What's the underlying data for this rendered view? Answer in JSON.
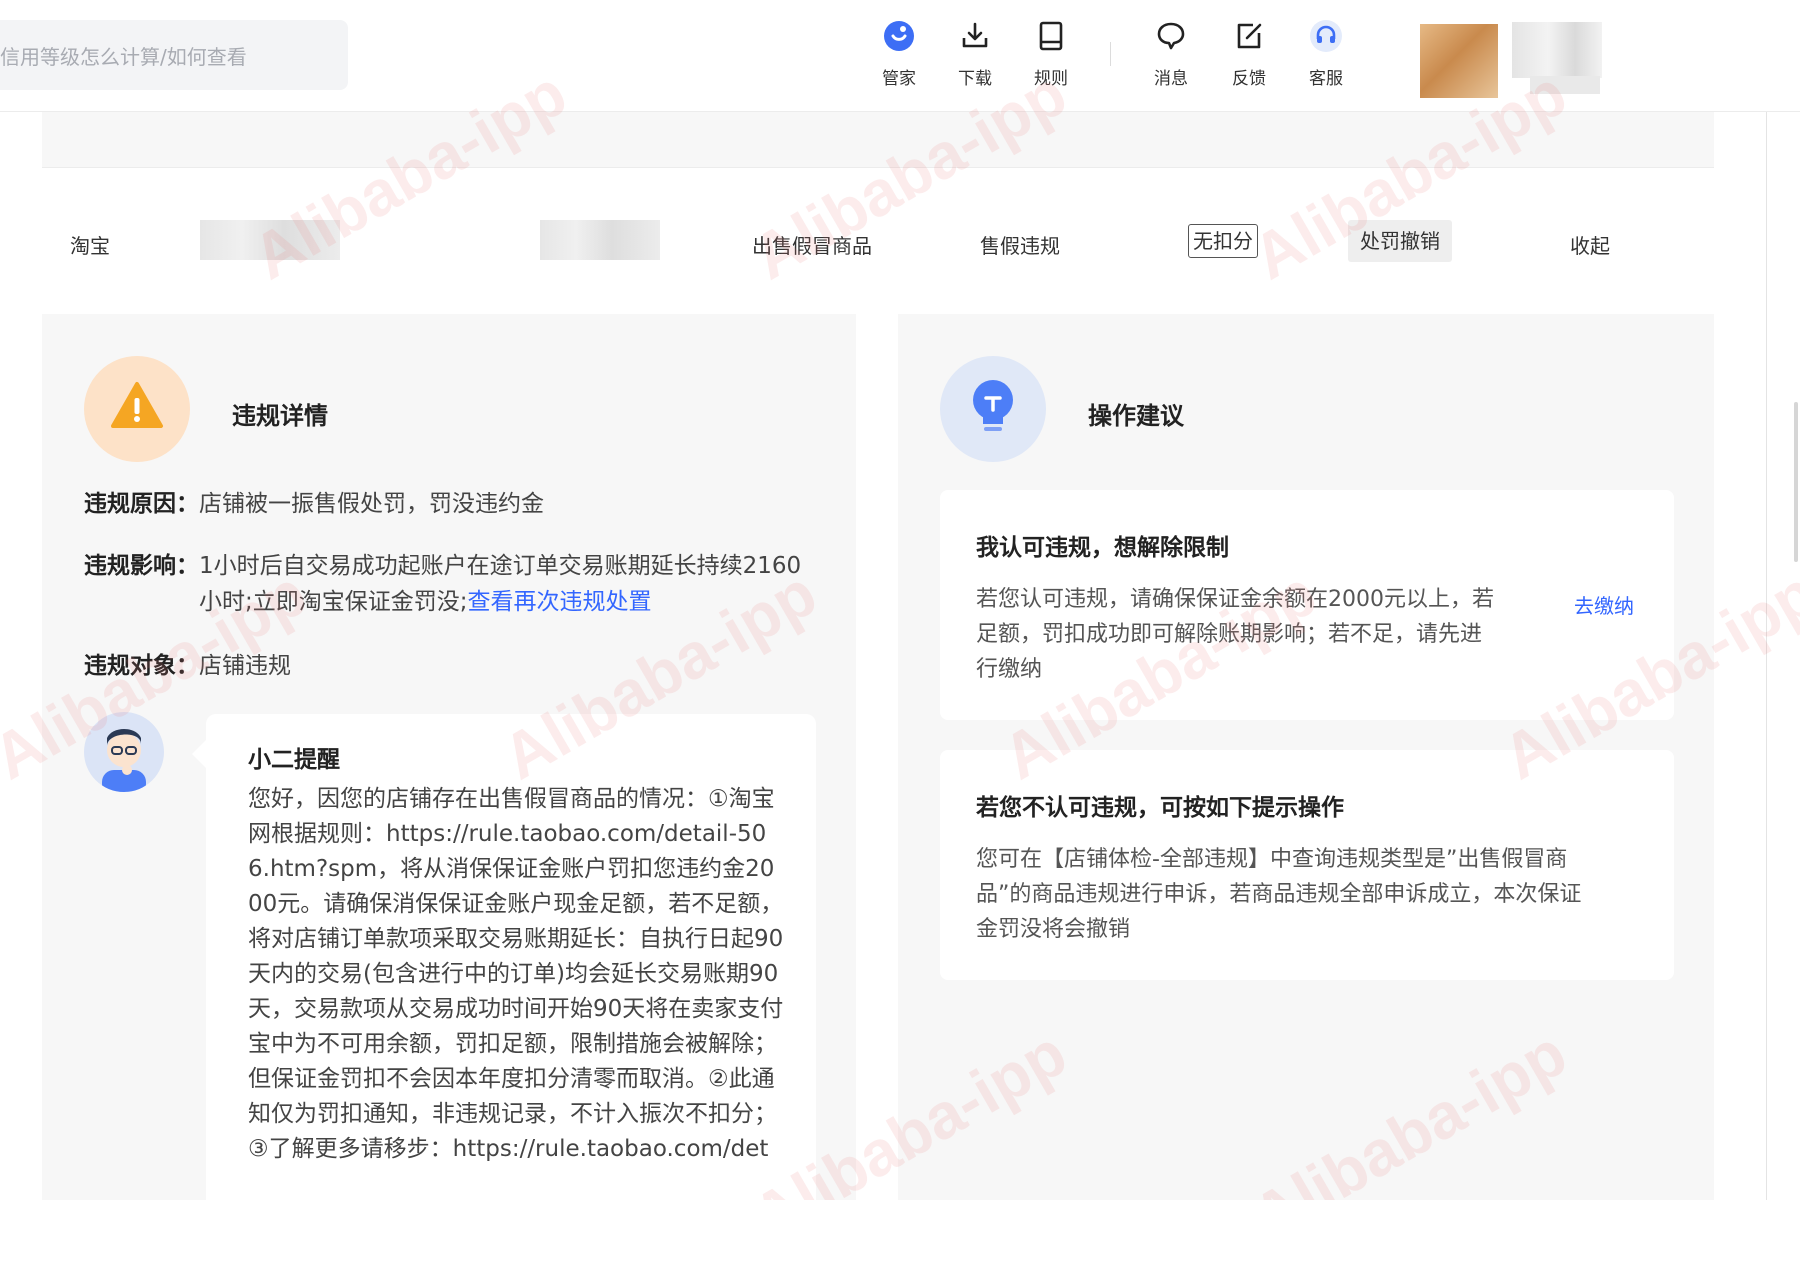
{
  "search": {
    "placeholder": "信用等级怎么计算/如何查看"
  },
  "toolbar": {
    "manager": "管家",
    "download": "下载",
    "rules": "规则",
    "messages": "消息",
    "feedback": "反馈",
    "service": "客服"
  },
  "row": {
    "platform": "淘宝",
    "violation_behavior": "出售假冒商品",
    "violation_type": "售假违规",
    "score_tag": "无扣分",
    "status_tag": "处罚撤销",
    "collapse_link": "收起"
  },
  "left_panel": {
    "title": "违规详情",
    "reason_label": "违规原因：",
    "reason_value": "店铺被一振售假处罚，罚没违约金",
    "impact_label": "违规影响：",
    "impact_value": "1小时后自交易成功起账户在途订单交易账期延长持续2160小时;立即淘宝保证金罚没;",
    "impact_link": "查看再次违规处置",
    "target_label": "违规对象：",
    "target_value": "店铺违规",
    "reminder_title": "小二提醒",
    "reminder_text": "您好，因您的店铺存在出售假冒商品的情况：①淘宝网根据规则：https://rule.taobao.com/detail-506.htm?spm，将从消保保证金账户罚扣您违约金2000元。请确保消保保证金账户现金足额，若不足额，将对店铺订单款项采取交易账期延长：自执行日起90天内的交易(包含进行中的订单)均会延长交易账期90天，交易款项从交易成功时间开始90天将在卖家支付宝中为不可用余额，罚扣足额，限制措施会被解除；但保证金罚扣不会因本年度扣分清零而取消。②此通知仅为罚扣通知，非违规记录，不计入振次不扣分；③了解更多请移步：https://rule.taobao.com/det"
  },
  "right_panel": {
    "title": "操作建议",
    "card1_title": "我认可违规，想解除限制",
    "card1_text": "若您认可违规，请确保保证金余额在2000元以上，若足额，罚扣成功即可解除账期影响；若不足，请先进行缴纳",
    "card1_action": "去缴纳",
    "card2_title": "若您不认可违规，可按如下提示操作",
    "card2_text": "您可在【店铺体检-全部违规】中查询违规类型是”出售假冒商品”的商品违规进行申诉，若商品违规全部申诉成立，本次保证金罚没将会撤销"
  },
  "watermark": "Alibaba-ipp",
  "colors": {
    "link": "#3366ff",
    "warn": "#f5a623",
    "bulb": "#4d7ef7",
    "panel_bg": "#f7f7f7"
  },
  "icons": [
    "manager-icon",
    "download-icon",
    "rules-icon",
    "message-icon",
    "feedback-icon",
    "service-icon",
    "warning-icon",
    "bulb-icon",
    "bot-avatar-icon"
  ]
}
